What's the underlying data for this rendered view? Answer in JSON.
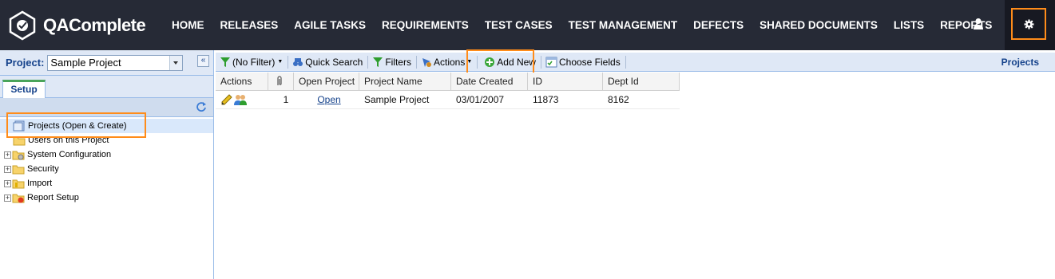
{
  "app": {
    "name": "QAComplete",
    "nav": [
      "HOME",
      "RELEASES",
      "AGILE TASKS",
      "REQUIREMENTS",
      "TEST CASES",
      "TEST MANAGEMENT",
      "DEFECTS",
      "SHARED DOCUMENTS",
      "LISTS",
      "REPORTS"
    ],
    "colors": {
      "topbar": "#262a36",
      "highlight": "#ff8c1a",
      "accent": "#15428b"
    }
  },
  "left": {
    "project_label": "Project:",
    "project_value": "Sample Project",
    "tab": "Setup",
    "tree": [
      {
        "label": "Projects (Open & Create)",
        "icon": "projects-icon",
        "expander": false
      },
      {
        "label": "Users on this Project",
        "icon": "folder-users-icon",
        "expander": false
      },
      {
        "label": "System Configuration",
        "icon": "folder-gear-icon",
        "expander": true
      },
      {
        "label": "Security",
        "icon": "folder-icon",
        "expander": true
      },
      {
        "label": "Import",
        "icon": "folder-import-icon",
        "expander": true
      },
      {
        "label": "Report Setup",
        "icon": "folder-report-icon",
        "expander": true
      }
    ]
  },
  "toolbar": {
    "filter": "(No Filter)",
    "quick_search": "Quick Search",
    "filters": "Filters",
    "actions": "Actions",
    "add_new": "Add New",
    "choose_fields": "Choose Fields",
    "title": "Projects"
  },
  "grid": {
    "columns": [
      "Actions",
      "",
      "Open Project",
      "Project Name",
      "Date Created",
      "ID",
      "Dept Id"
    ],
    "rows": [
      {
        "attachments": "1",
        "open": "Open",
        "name": "Sample Project",
        "date": "03/01/2007",
        "id": "11873",
        "dept": "8162"
      }
    ]
  }
}
